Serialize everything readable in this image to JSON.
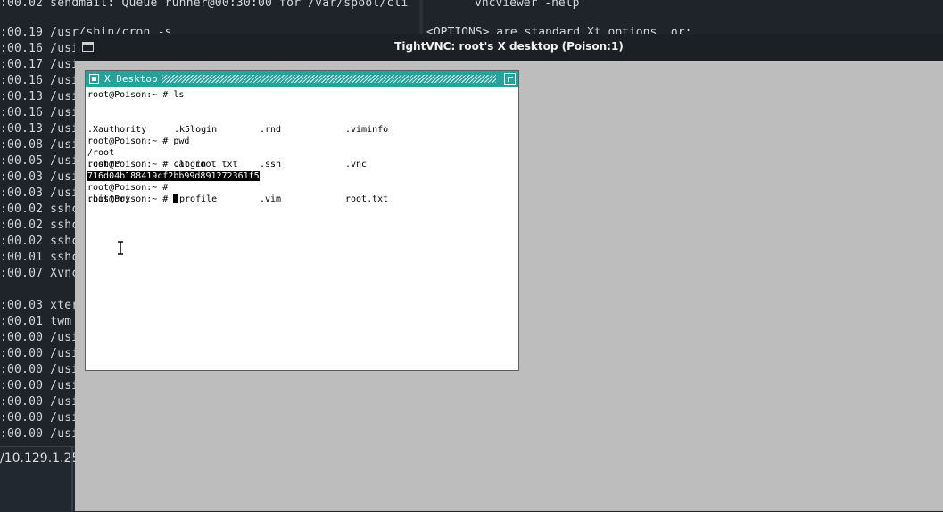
{
  "host_terminal_left": {
    "line_top": ":00.02 sendmail: Queue runner@00:30:00 for /var/spool/cli",
    "lines": [
      ":00.19 /usr/sbin/cron -s",
      ":00.16 /usi",
      ":00.17 /usi",
      ":00.16 /usi",
      ":00.13 /usi",
      ":00.16 /usi",
      ":00.13 /usi",
      ":00.08 /usi",
      ":00.05 /usi",
      ":00.03 /usi",
      ":00.03 /usi",
      ":00.02 sshc",
      ":00.02 sshc",
      ":00.02 sshc",
      ":00.01 sshc",
      ":00.07 Xvnc",
      "",
      ":00.03 xter",
      ":00.01 twm",
      ":00.00 /usi",
      ":00.00 /usi",
      ":00.00 /usi",
      ":00.00 /usi",
      ":00.00 /usi",
      ":00.00 /usi",
      ":00.00 /usi"
    ]
  },
  "host_terminal_right": {
    "line_top": "vncviewer -help",
    "line_second": "<OPTIONS> are standard Xt options, or:"
  },
  "host_status": {
    "text": "/10.129.1.254"
  },
  "vnc_window": {
    "title": "TightVNC: root's X desktop (Poison:1)"
  },
  "xterm": {
    "title": "X Desktop",
    "lines": {
      "cmd_ls": "root@Poison:~ # ls",
      "ls_col1": [
        ".Xauthority",
        ".cshrc",
        ".history"
      ],
      "ls_col2": [
        ".k5login",
        ".login",
        ".profile"
      ],
      "ls_col3": [
        ".rnd",
        ".ssh",
        ".vim"
      ],
      "ls_col4": [
        ".viminfo",
        ".vnc",
        "root.txt"
      ],
      "cmd_pwd": "root@Poison:~ # pwd",
      "pwd_out": "/root",
      "cmd_cat": "root@Poison:~ # cat root.txt",
      "cat_out": "716d04b188419cf2bb99d891272361f5",
      "prompt_empty": "root@Poison:~ #",
      "prompt_current": "root@Poison:~ # "
    }
  },
  "colors": {
    "twm_title": "#23a39b",
    "vnc_background": "#bdbdbd",
    "host_terminal_bg": "#1f242b"
  }
}
